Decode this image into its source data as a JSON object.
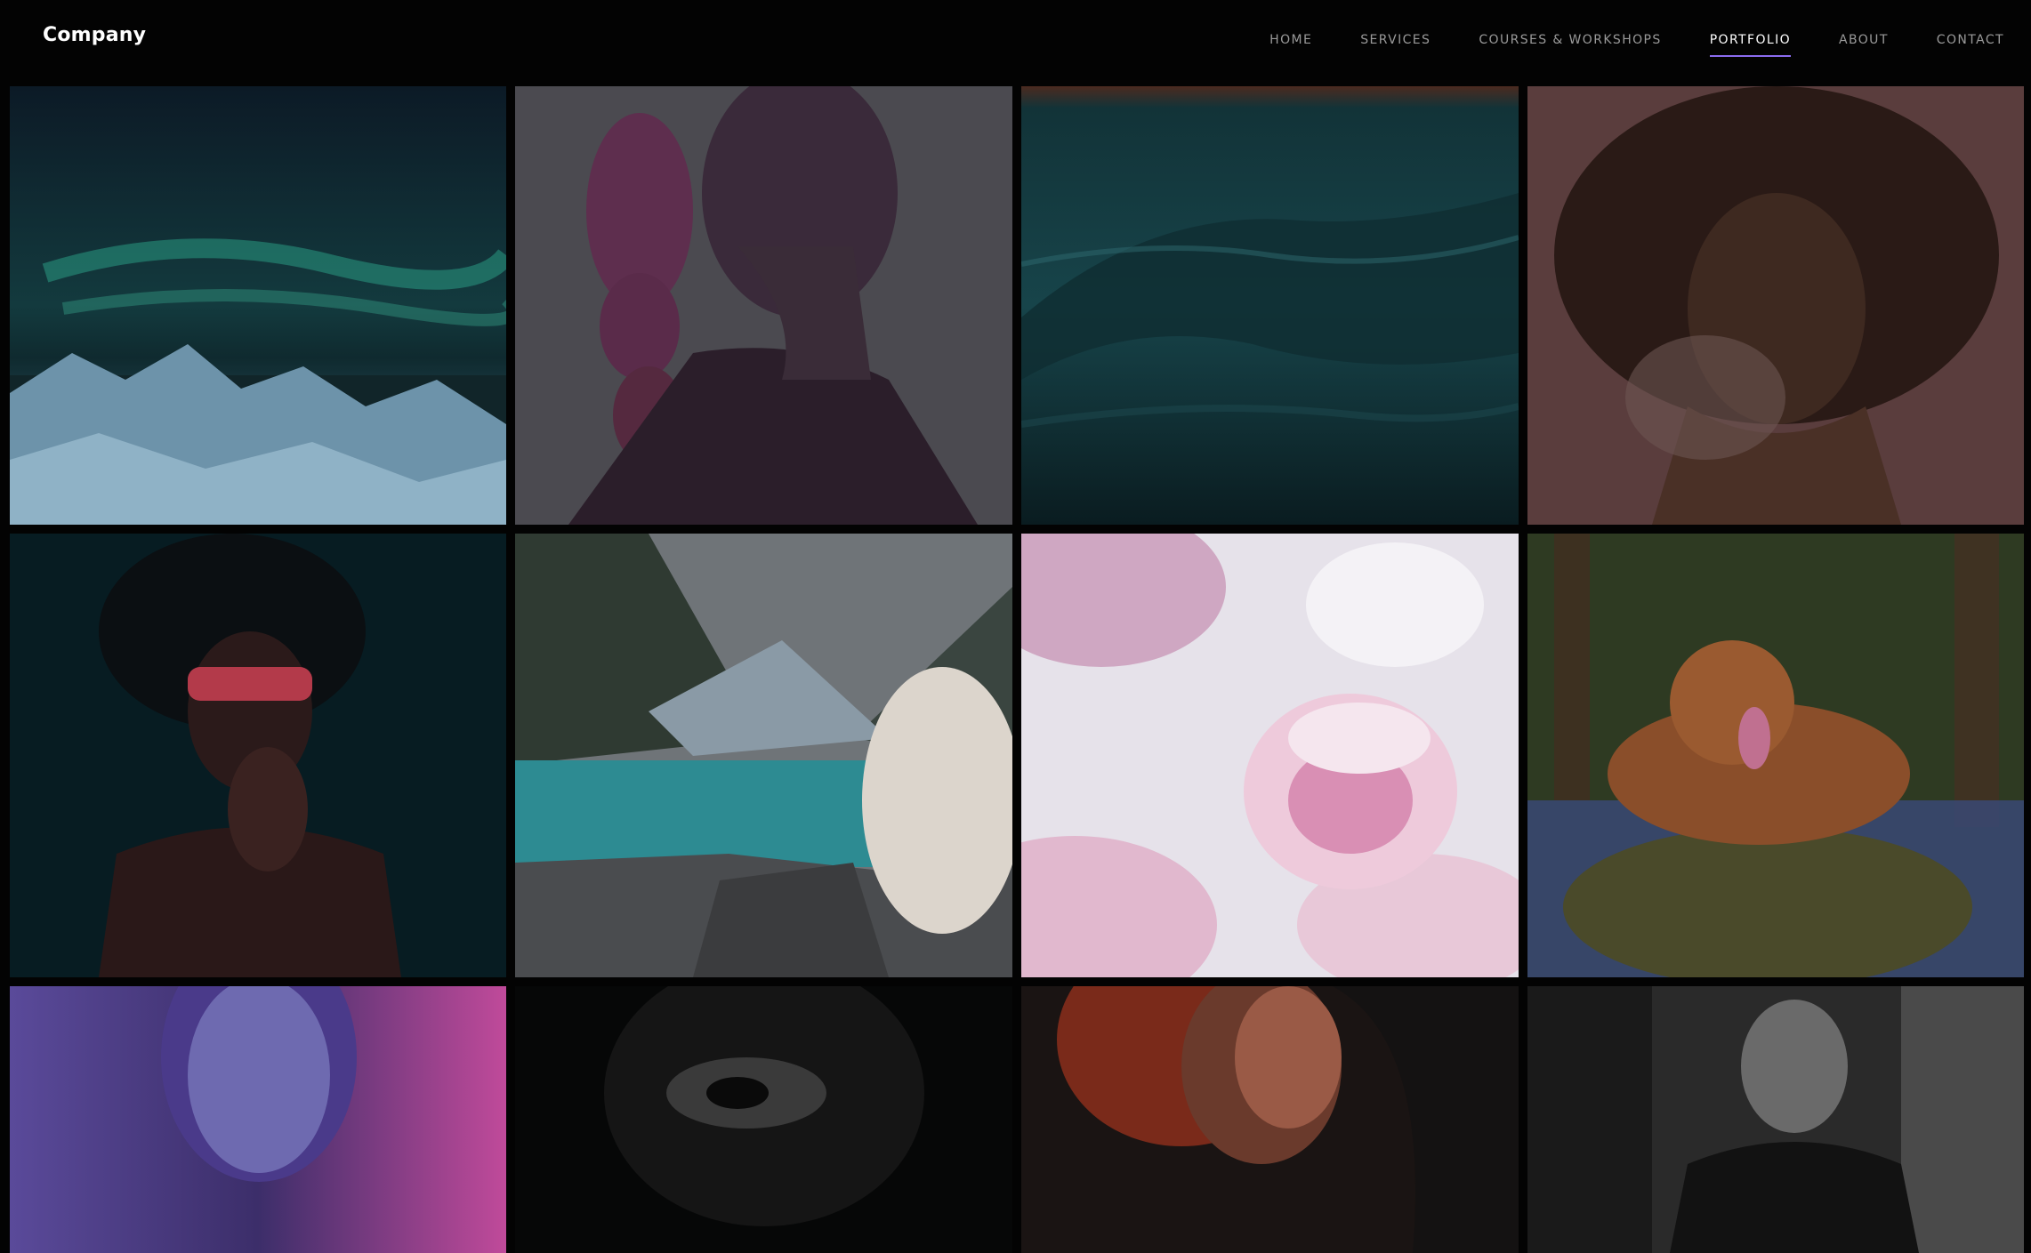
{
  "header": {
    "logo": "Company",
    "nav": [
      {
        "label": "HOME",
        "active": false
      },
      {
        "label": "SERVICES",
        "active": false
      },
      {
        "label": "COURSES & WORKSHOPS",
        "active": false
      },
      {
        "label": "PORTFOLIO",
        "active": true
      },
      {
        "label": "ABOUT",
        "active": false
      },
      {
        "label": "CONTACT",
        "active": false
      }
    ],
    "accent_color": "#8b6cf0"
  },
  "portfolio": {
    "photos": [
      {
        "subject": "aurora-over-icy-coast"
      },
      {
        "subject": "woman-braid-profile-pink"
      },
      {
        "subject": "teal-ocean-wave-closeup"
      },
      {
        "subject": "woman-curly-hair-portrait"
      },
      {
        "subject": "woman-sunglasses-hands-clasped"
      },
      {
        "subject": "white-dog-mountain-lake"
      },
      {
        "subject": "pink-magnolia-flower"
      },
      {
        "subject": "dog-on-mossy-rock-bluebells"
      },
      {
        "subject": "woman-face-glitter-neon"
      },
      {
        "subject": "bw-portrait-eyes"
      },
      {
        "subject": "woman-red-hair-hood"
      },
      {
        "subject": "bw-man-portrait-ruins"
      }
    ]
  }
}
